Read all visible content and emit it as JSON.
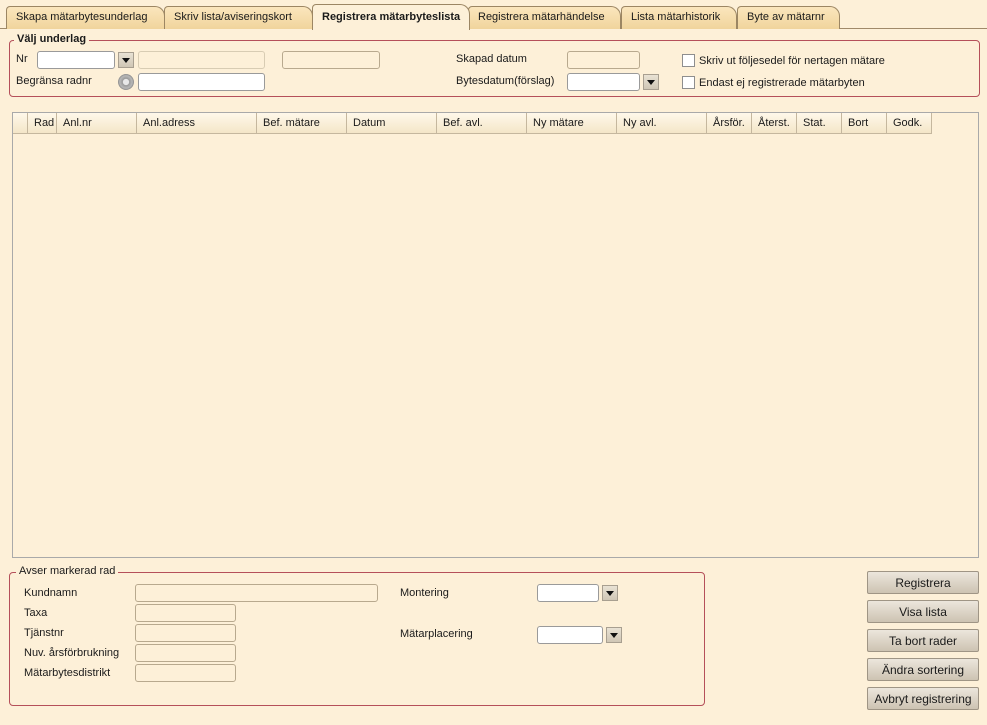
{
  "tabs": [
    {
      "label": "Skapa mätarbytesunderlag",
      "active": false
    },
    {
      "label": "Skriv lista/aviseringskort",
      "active": false
    },
    {
      "label": "Registrera mätarbyteslista",
      "active": true
    },
    {
      "label": "Registrera mätarhändelse",
      "active": false
    },
    {
      "label": "Lista mätarhistorik",
      "active": false
    },
    {
      "label": "Byte av mätarnr",
      "active": false
    }
  ],
  "valj_underlag": {
    "legend": "Välj underlag",
    "nr_label": "Nr",
    "nr_value": "",
    "begransa_label": "Begränsa radnr",
    "begransa_value": "",
    "skapad_label": "Skapad datum",
    "skapad_value": "",
    "bytesdatum_label": "Bytesdatum(förslag)",
    "bytesdatum_value": "",
    "chk_foljesedel_label": "Skriv ut följesedel för nertagen mätare",
    "chk_endast_label": "Endast ej registrerade mätarbyten"
  },
  "grid": {
    "columns": [
      "Rad",
      "Anl.nr",
      "Anl.adress",
      "Bef. mätare",
      "Datum",
      "Bef. avl.",
      "Ny mätare",
      "Ny avl.",
      "Årsför.",
      "Återst.",
      "Stat.",
      "Bort",
      "Godk."
    ],
    "rows": []
  },
  "avser": {
    "legend": "Avser markerad rad",
    "kundnamn_label": "Kundnamn",
    "taxa_label": "Taxa",
    "tjanstnr_label": "Tjänstnr",
    "arsforbrukning_label": "Nuv. årsförbrukning",
    "distrikt_label": "Mätarbytesdistrikt",
    "montering_label": "Montering",
    "placering_label": "Mätarplacering"
  },
  "buttons": {
    "registrera": "Registrera",
    "visa_lista": "Visa lista",
    "ta_bort": "Ta bort rader",
    "andra_sortering": "Ändra sortering",
    "avbryt": "Avbryt registrering"
  },
  "colors": {
    "background": "#fdf0d8",
    "group_border": "#b5505a",
    "tab": "#f0d49c"
  }
}
